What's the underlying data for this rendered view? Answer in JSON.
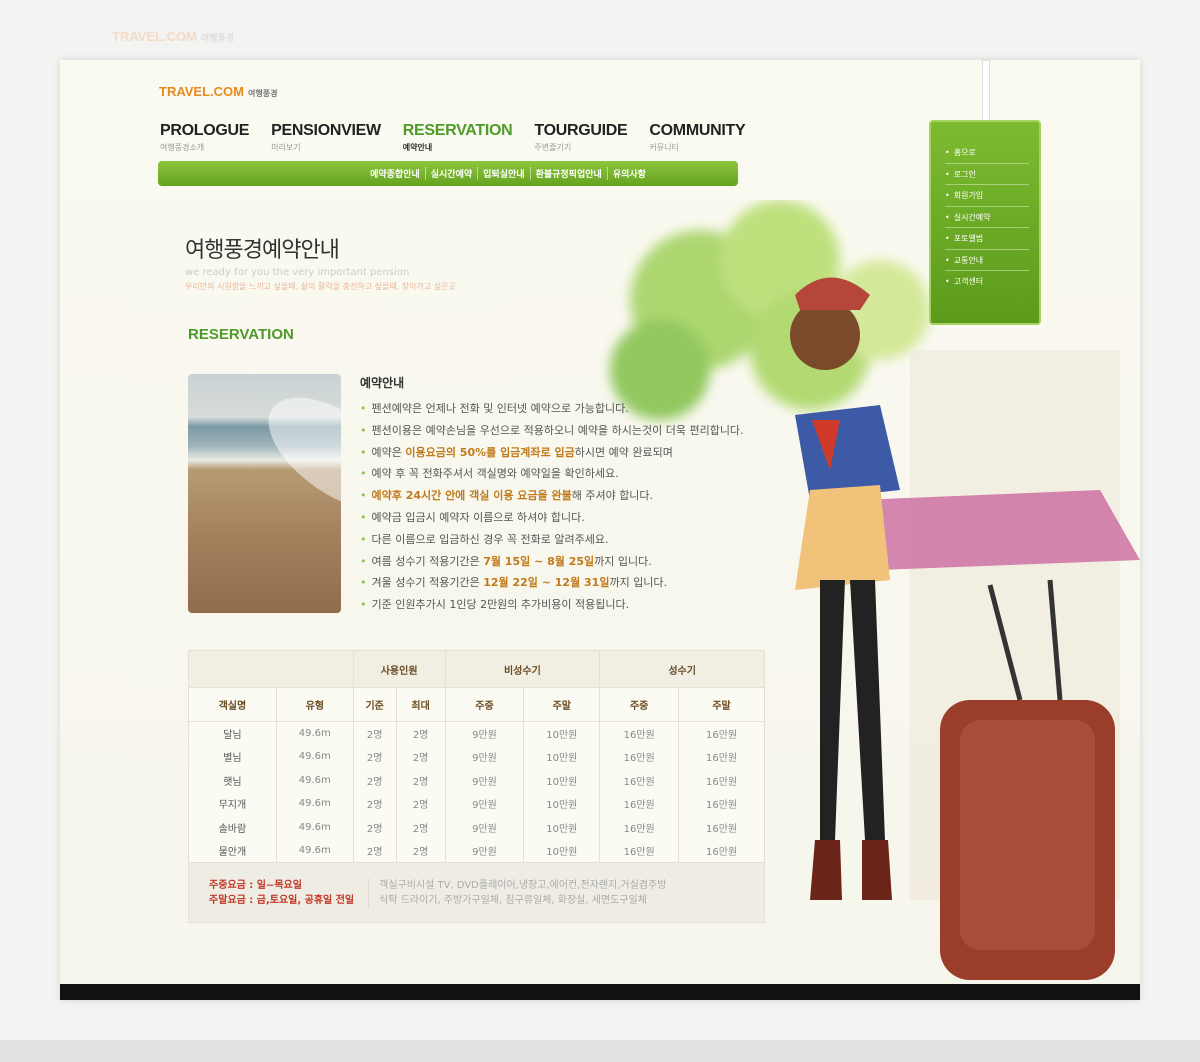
{
  "ghost_logo": {
    "brand": "TRAVEL.COM",
    "sub": "여행풍경"
  },
  "logo": {
    "brand": "TRAVEL.COM",
    "sub": "여행풍경"
  },
  "nav": [
    {
      "title": "PROLOGUE",
      "sub": "여행풍경소개"
    },
    {
      "title": "PENSIONVIEW",
      "sub": "미리보기"
    },
    {
      "title": "RESERVATION",
      "sub": "예약안내",
      "active": true
    },
    {
      "title": "TOURGUIDE",
      "sub": "주변즐기기"
    },
    {
      "title": "COMMUNITY",
      "sub": "커뮤니티"
    }
  ],
  "subnav": [
    "예약종합안내",
    "실시간예약",
    "입퇴실안내",
    "환불규정픽업안내",
    "유의사항"
  ],
  "side_menu": [
    "홈으로",
    "로그인",
    "회원가입",
    "실시간예약",
    "포토앨범",
    "교통안내",
    "고객센터"
  ],
  "page_title": "여행풍경예약안내",
  "tagline": "we ready for you the very important pension",
  "tagline_ko": "우리만의 시원함을 느끼고 싶을때, 삶의 활력을 충전하고 싶을때, 찾아가고 싶은곳",
  "section_title": "RESERVATION",
  "info": {
    "heading": "예약안내",
    "items": [
      {
        "pre": "펜션예약은 언제나 전화 및 인터넷 예약으로 가능합니다.",
        "hl": "",
        "post": ""
      },
      {
        "pre": "펜션이용은 예약손님을 우선으로 적용하오니 예약을 하시는것이 더욱 편리합니다.",
        "hl": "",
        "post": ""
      },
      {
        "pre": "예약은 ",
        "hl": "이용요금의 50%를 입금계좌로 입금",
        "post": "하시면 예약 완료되며"
      },
      {
        "pre": "예약 후 꼭 전화주셔서 객실명와 예약일을 확인하세요.",
        "hl": "",
        "post": ""
      },
      {
        "pre": "",
        "hl": "예약후 24시간 안에 객실 이용 요금을 완불",
        "post": "해 주셔야 합니다."
      },
      {
        "pre": "예약금 입금시 예약자 이름으로 하셔야 합니다.",
        "hl": "",
        "post": ""
      },
      {
        "pre": "다른 이름으로 입금하신 경우 꼭 전화로 알려주세요.",
        "hl": "",
        "post": ""
      },
      {
        "pre": "여름 성수기 적용기간은 ",
        "hl": "7월 15일 ~ 8월 25일",
        "post": "까지 입니다."
      },
      {
        "pre": "겨울 성수기 적용기간은 ",
        "hl": "12월 22일 ~ 12월 31일",
        "post": "까지 입니다."
      },
      {
        "pre": "기준 인원추가시 1인당 2만원의 추가비용이 적용됩니다.",
        "hl": "",
        "post": ""
      }
    ]
  },
  "table": {
    "group_headers": [
      "사용인원",
      "비성수기",
      "성수기"
    ],
    "headers": [
      "객실명",
      "유형",
      "기준",
      "최대",
      "주중",
      "주말",
      "주중",
      "주말"
    ],
    "rows": [
      [
        "달님",
        "49.6m",
        "2명",
        "2명",
        "9만원",
        "10만원",
        "16만원",
        "16만원"
      ],
      [
        "별님",
        "49.6m",
        "2명",
        "2명",
        "9만원",
        "10만원",
        "16만원",
        "16만원"
      ],
      [
        "햇님",
        "49.6m",
        "2명",
        "2명",
        "9만원",
        "10만원",
        "16만원",
        "16만원"
      ],
      [
        "무지개",
        "49.6m",
        "2명",
        "2명",
        "9만원",
        "10만원",
        "16만원",
        "16만원"
      ],
      [
        "솔바람",
        "49.6m",
        "2명",
        "2명",
        "9만원",
        "10만원",
        "16만원",
        "16만원"
      ],
      [
        "물안개",
        "49.6m",
        "2명",
        "2명",
        "9만원",
        "10만원",
        "16만원",
        "16만원"
      ]
    ],
    "notes_left": [
      "주중요금 : 일~목요일",
      "주말요금 : 금,토요일, 공휴일 전일"
    ],
    "notes_right": [
      "객실구비시설 TV, DVD플레이어,냉장고,에어컨,전자렌지,거실겸주방",
      "식탁 드라이기, 주방가구일체, 침구류일체, 화장실, 세면도구일체"
    ]
  },
  "colors": {
    "accent_green": "#4e9a2a",
    "nav_bar": "#6fae27",
    "highlight": "#c98a2b",
    "logo_orange": "#e58a1d"
  }
}
